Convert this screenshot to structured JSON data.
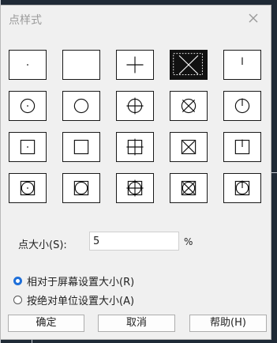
{
  "dialog": {
    "title": "点样式",
    "close_glyph": "×",
    "point_styles": [
      {
        "id": "dot",
        "selected": false
      },
      {
        "id": "none",
        "selected": false
      },
      {
        "id": "plus",
        "selected": false
      },
      {
        "id": "x",
        "selected": true
      },
      {
        "id": "tick",
        "selected": false
      },
      {
        "id": "circle-dot",
        "selected": false
      },
      {
        "id": "circle",
        "selected": false
      },
      {
        "id": "circle-plus",
        "selected": false
      },
      {
        "id": "circle-x",
        "selected": false
      },
      {
        "id": "circle-tick",
        "selected": false
      },
      {
        "id": "square-dot",
        "selected": false
      },
      {
        "id": "square",
        "selected": false
      },
      {
        "id": "square-plus",
        "selected": false
      },
      {
        "id": "square-x",
        "selected": false
      },
      {
        "id": "square-tick",
        "selected": false
      },
      {
        "id": "square-circle-dot",
        "selected": false
      },
      {
        "id": "square-circle",
        "selected": false
      },
      {
        "id": "square-circle-plus",
        "selected": false
      },
      {
        "id": "square-circle-x",
        "selected": false
      },
      {
        "id": "square-circle-tick",
        "selected": false
      }
    ],
    "point_size_label": "点大小(S):",
    "point_size_value": "5",
    "percent_sign": "%",
    "radio_relative_label": "相对于屏幕设置大小(R)",
    "radio_relative_checked": true,
    "radio_absolute_label": "按绝对单位设置大小(A)",
    "radio_absolute_checked": false,
    "ok_label": "确定",
    "cancel_label": "取消",
    "help_label": "帮助(H)"
  }
}
